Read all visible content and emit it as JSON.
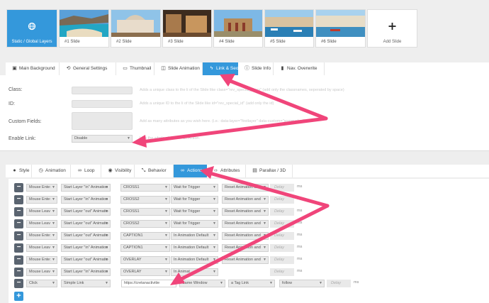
{
  "slides": [
    {
      "label": "Static / Global Layers",
      "kind": "static"
    },
    {
      "label": "#1 Slide"
    },
    {
      "label": "#2 Slide"
    },
    {
      "label": "#3 Slide"
    },
    {
      "label": "#4 Slide"
    },
    {
      "label": "#5 Slide"
    },
    {
      "label": "#6 Slide"
    },
    {
      "label": "Add Slide",
      "kind": "add"
    }
  ],
  "slide_tabs": [
    {
      "label": "Main Background",
      "icon": "image-icon"
    },
    {
      "label": "General Settings",
      "icon": "history-icon"
    },
    {
      "label": "Thumbnail",
      "icon": "thumbnail-icon"
    },
    {
      "label": "Slide Animation",
      "icon": "animation-icon"
    },
    {
      "label": "Link & Seo",
      "icon": "bolt-icon",
      "active": true
    },
    {
      "label": "Slide Info",
      "icon": "info-icon"
    },
    {
      "label": "Nav. Overwrite",
      "icon": "nav-icon"
    }
  ],
  "form": {
    "class_label": "Class:",
    "class_hint": "Adds a unique class to the li of the Slide like class=\"rev_special_class\" (add only the classnames, seperated by space)",
    "id_label": "ID:",
    "id_hint": "Adds a unique ID to the li of the Slide like id=\"rev_special_id\" (add only the id)",
    "custom_label": "Custom Fields:",
    "custom_hint": "Add as many attributes as you wish here. (i.e.: data-layer=\"firstlayer\" data-custom=\"somevalue\").",
    "enable_link_label": "Enable Link:",
    "enable_link_value": "Disable",
    "enable_link_hint": "Link the whole slide with an Action."
  },
  "layer_tabs": [
    {
      "label": "Style",
      "icon": "drop-icon"
    },
    {
      "label": "Animation",
      "icon": "clock-icon"
    },
    {
      "label": "Loop",
      "icon": "loop-icon"
    },
    {
      "label": "Visibility",
      "icon": "eye-icon"
    },
    {
      "label": "Behavior",
      "icon": "resize-icon"
    },
    {
      "label": "Actions",
      "icon": "link-icon",
      "active": true
    },
    {
      "label": "Attributes",
      "icon": "code-icon"
    },
    {
      "label": "Parallax / 3D",
      "icon": "parallax-icon"
    }
  ],
  "actions": [
    {
      "event": "Mouse Ente:",
      "action": "Start Layer \"in\" Animation",
      "target": "CROSS1",
      "trigger": "Wait for Trigger",
      "reset": "Reset Animation and",
      "delay": "Delay",
      "unit": "ms"
    },
    {
      "event": "Mouse Ente:",
      "action": "Start Layer \"in\" Animation",
      "target": "CROSS2",
      "trigger": "Wait for Trigger",
      "reset": "Reset Animation and",
      "delay": "Delay",
      "unit": "ms"
    },
    {
      "event": "Mouse Leav",
      "action": "Start Layer \"out\" Animatio",
      "target": "CROSS1",
      "trigger": "Wait for Trigger",
      "reset": "Reset Animation and",
      "delay": "Delay",
      "unit": "ms"
    },
    {
      "event": "Mouse Leav",
      "action": "Start Layer \"out\" Animatio",
      "target": "CROSS2",
      "trigger": "Wait for Trigger",
      "reset": "Reset Animation and",
      "delay": "Delay",
      "unit": "ms"
    },
    {
      "event": "Mouse Ente:",
      "action": "Start Layer \"out\" Animatio",
      "target": "CAPTION1",
      "trigger": "In Animation Default",
      "reset": "Reset Animation and",
      "delay": "Delay",
      "unit": "ms"
    },
    {
      "event": "Mouse Leav",
      "action": "Start Layer \"in\" Animation",
      "target": "CAPTION1",
      "trigger": "In Animation Default",
      "reset": "Reset Animation and",
      "delay": "Delay",
      "unit": "ms"
    },
    {
      "event": "Mouse Ente:",
      "action": "Start Layer \"out\" Animatio",
      "target": "OVERLAY",
      "trigger": "In Animation Default",
      "reset": "Reset Animation and",
      "delay": "Delay",
      "unit": "ms"
    },
    {
      "event": "Mouse Leav",
      "action": "Start Layer \"in\" Animation",
      "target": "OVERLAY",
      "trigger": "In Animat",
      "reset": "",
      "delay": "Delay",
      "unit": "ms"
    }
  ],
  "link_action": {
    "event": "Click",
    "action": "Simple Link",
    "url": "https://cretanactivitie",
    "window": "Same Window",
    "tag": "a Tag Link",
    "follow": "follow",
    "delay": "Delay",
    "unit": "ms"
  },
  "colors": {
    "accent": "#3498db",
    "arrow": "#f0457a",
    "minus": "#5a6470"
  }
}
